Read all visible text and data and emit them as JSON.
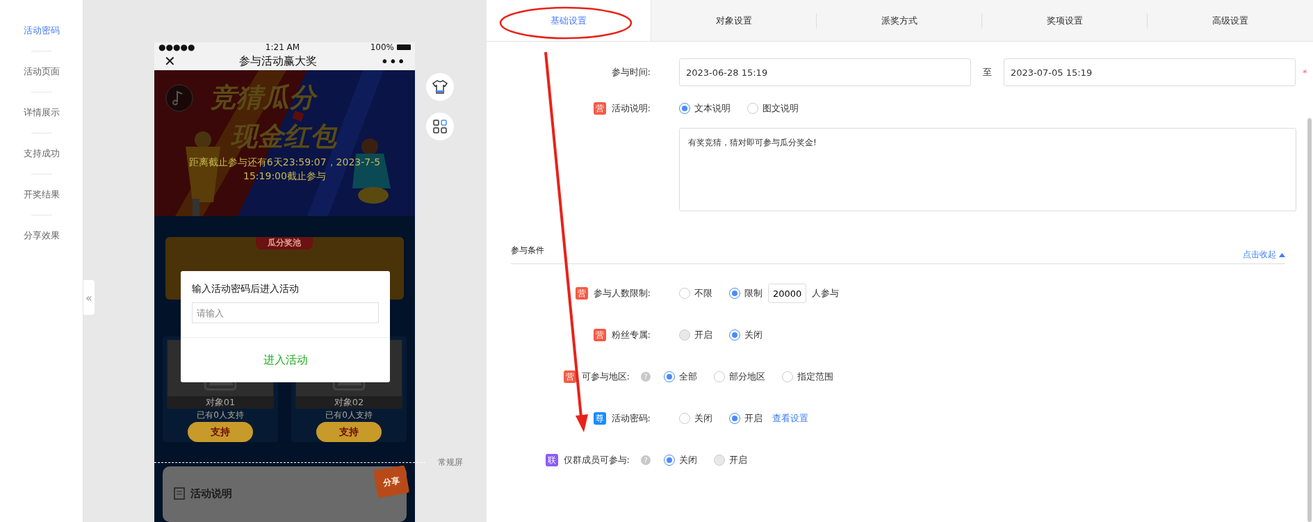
{
  "sidebar": {
    "items": [
      {
        "label": "活动密码",
        "selected": true
      },
      {
        "label": "活动页面",
        "selected": false
      },
      {
        "label": "详情展示",
        "selected": false
      },
      {
        "label": "支持成功",
        "selected": false
      },
      {
        "label": "开奖结果",
        "selected": false
      },
      {
        "label": "分享效果",
        "selected": false
      }
    ],
    "collapse": "«"
  },
  "phone": {
    "status": {
      "signal": "●●●●●",
      "time": "1:21 AM",
      "battery": "100%"
    },
    "nav": {
      "close": "✕",
      "title": "参与活动赢大奖",
      "more": "•••"
    },
    "banner": {
      "title": [
        "竞猜瓜分",
        "现金红包"
      ],
      "countdown": "距离截止参与还有6天23:59:07，2023-7-5 15:19:00截止参与"
    },
    "pool": {
      "label": "瓜分奖池"
    },
    "objects": [
      {
        "name": "对象01",
        "supporters": "已有0人支持",
        "button": "支持"
      },
      {
        "name": "对象02",
        "supporters": "已有0人支持",
        "button": "支持"
      }
    ],
    "share": "分享",
    "section_title": "活动说明",
    "screen_mark": "常规屏",
    "dialog": {
      "title": "输入活动密码后进入活动",
      "placeholder": "请输入",
      "button": "进入活动"
    }
  },
  "tabs": [
    {
      "label": "基础设置",
      "selected": true
    },
    {
      "label": "对象设置",
      "selected": false
    },
    {
      "label": "派奖方式",
      "selected": false
    },
    {
      "label": "奖项设置",
      "selected": false
    },
    {
      "label": "高级设置",
      "selected": false
    }
  ],
  "time": {
    "label": "参与时间:",
    "start": "2023-06-28 15:19",
    "separator": "至",
    "end": "2023-07-05 15:19",
    "required": "*"
  },
  "description": {
    "badge": {
      "text": "营",
      "color": "#f25c45"
    },
    "label": "活动说明:",
    "options": [
      {
        "label": "文本说明",
        "selected": true,
        "disabled": false
      },
      {
        "label": "图文说明",
        "selected": false,
        "disabled": false
      }
    ],
    "text": "有奖竞猜，猜对即可参与瓜分奖金!"
  },
  "conditions": {
    "title": "参与条件",
    "toggle": "点击收起",
    "rows": [
      {
        "badge": {
          "text": "营",
          "color": "#f25c45"
        },
        "label": "参与人数限制:",
        "options": [
          {
            "label": "不限",
            "selected": false,
            "disabled": false
          },
          {
            "label": "限制",
            "selected": true,
            "disabled": false
          }
        ],
        "limit": "20000",
        "suffix": "人参与"
      },
      {
        "badge": {
          "text": "营",
          "color": "#f25c45"
        },
        "label": "粉丝专属:",
        "options": [
          {
            "label": "开启",
            "selected": false,
            "disabled": true
          },
          {
            "label": "关闭",
            "selected": true,
            "disabled": false
          }
        ]
      },
      {
        "badge": {
          "text": "营",
          "color": "#f25c45"
        },
        "label": "可参与地区:",
        "help": "?",
        "options": [
          {
            "label": "全部",
            "selected": true,
            "disabled": false
          },
          {
            "label": "部分地区",
            "selected": false,
            "disabled": false
          },
          {
            "label": "指定范围",
            "selected": false,
            "disabled": false
          }
        ]
      },
      {
        "badge": {
          "text": "尊",
          "color": "#1a8cff"
        },
        "label": "活动密码:",
        "options": [
          {
            "label": "关闭",
            "selected": false,
            "disabled": false
          },
          {
            "label": "开启",
            "selected": true,
            "disabled": false
          }
        ],
        "link": "查看设置"
      },
      {
        "badge": {
          "text": "联",
          "color": "#8b5cf6"
        },
        "label": "仅群成员可参与:",
        "help": "?",
        "options": [
          {
            "label": "关闭",
            "selected": true,
            "disabled": false
          },
          {
            "label": "开启",
            "selected": false,
            "disabled": true
          }
        ]
      }
    ]
  }
}
